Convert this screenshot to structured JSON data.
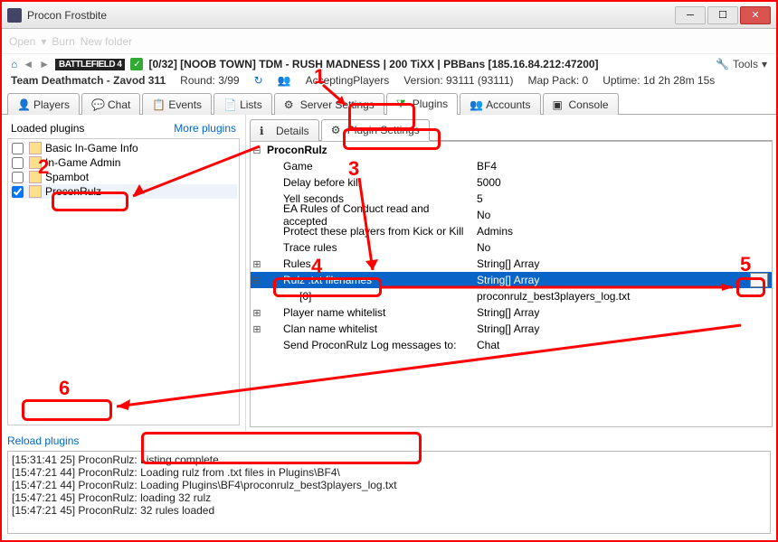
{
  "window": {
    "title": "Procon Frostbite"
  },
  "toolbar_faded": [
    "Open",
    "Burn",
    "New folder"
  ],
  "server": {
    "logo": "BATTLEFIELD 4",
    "name": "[0/32] [NOOB TOWN] TDM - RUSH MADNESS | 200 TiXX | PBBans [185.16.84.212:47200]",
    "tools_label": "Tools"
  },
  "status": {
    "map": "Team Deathmatch - Zavod 311",
    "round": "Round: 3/99",
    "state": "AcceptingPlayers",
    "version": "Version: 93111 (93111)",
    "mappack": "Map Pack: 0",
    "uptime": "Uptime: 1d 2h 28m 15s"
  },
  "tabs": {
    "players": "Players",
    "chat": "Chat",
    "events": "Events",
    "lists": "Lists",
    "serversettings": "Server Settings",
    "plugins": "Plugins",
    "accounts": "Accounts",
    "console": "Console"
  },
  "left": {
    "header": "Loaded plugins",
    "more": "More plugins",
    "items": [
      {
        "label": "Basic In-Game Info",
        "checked": false
      },
      {
        "label": "In-Game Admin",
        "checked": false
      },
      {
        "label": "Spambot",
        "checked": false
      },
      {
        "label": "ProconRulz",
        "checked": true
      }
    ],
    "reload": "Reload plugins"
  },
  "subtabs": {
    "details": "Details",
    "settings": "Plugin Settings"
  },
  "grid": {
    "category": "ProconRulz",
    "rows": [
      {
        "k": "Game",
        "v": "BF4"
      },
      {
        "k": "Delay before kill",
        "v": "5000"
      },
      {
        "k": "Yell seconds",
        "v": "5"
      },
      {
        "k": "EA Rules of Conduct read and accepted",
        "v": "No"
      },
      {
        "k": "Protect these players from Kick or Kill",
        "v": "Admins"
      },
      {
        "k": "Trace rules",
        "v": "No"
      },
      {
        "k": "Rules",
        "v": "String[] Array",
        "exp": true
      },
      {
        "k": "Rulz .txt filenames",
        "v": "String[] Array",
        "exp": true,
        "selected": true
      },
      {
        "k": "[0]",
        "v": "proconrulz_best3players_log.txt",
        "child": true
      },
      {
        "k": "Player name whitelist",
        "v": "String[] Array",
        "exp": true
      },
      {
        "k": "Clan name whitelist",
        "v": "String[] Array",
        "exp": true
      },
      {
        "k": "Send ProconRulz Log messages to:",
        "v": "Chat"
      }
    ]
  },
  "console_lines": [
    "[15:31:41 25] ProconRulz: Listing complete",
    "[15:47:21 44] ProconRulz: Loading rulz from .txt files in Plugins\\BF4\\",
    "[15:47:21 44] ProconRulz: Loading Plugins\\BF4\\proconrulz_best3players_log.txt",
    "[15:47:21 45] ProconRulz: loading 32 rulz",
    "[15:47:21 45] ProconRulz: 32 rules loaded"
  ],
  "annotations": [
    "1",
    "2",
    "3",
    "4",
    "5",
    "6"
  ]
}
